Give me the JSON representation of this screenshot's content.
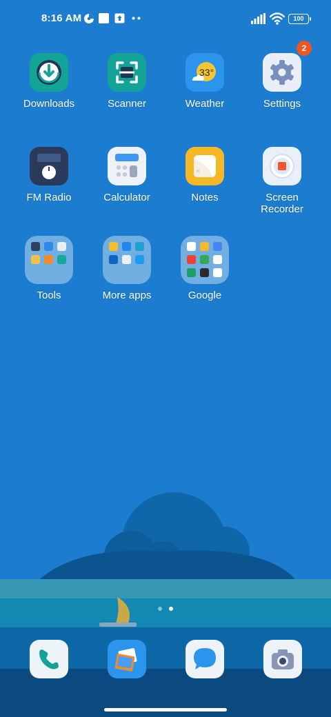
{
  "status_bar": {
    "time": "8:16 AM",
    "battery": "100",
    "icons": [
      "data-saver-icon",
      "app-notification-icon",
      "upload-icon",
      "more-notifications-icon",
      "signal-icon",
      "wifi-icon",
      "battery-icon"
    ]
  },
  "apps": [
    {
      "label": "Downloads",
      "icon": "downloads-icon"
    },
    {
      "label": "Scanner",
      "icon": "scanner-icon"
    },
    {
      "label": "Weather",
      "icon": "weather-icon",
      "temperature": "33°"
    },
    {
      "label": "Settings",
      "icon": "settings-icon",
      "badge": "2"
    },
    {
      "label": "FM Radio",
      "icon": "fm-radio-icon"
    },
    {
      "label": "Calculator",
      "icon": "calculator-icon"
    },
    {
      "label": "Notes",
      "icon": "notes-icon"
    },
    {
      "label": "Screen Recorder",
      "icon": "screen-recorder-icon"
    }
  ],
  "folders": [
    {
      "label": "Tools",
      "mini_icons": [
        "#2f3e5c",
        "#2c8be8",
        "#e9edf4",
        "#f2c14a",
        "#f28c28",
        "#18a79a"
      ]
    },
    {
      "label": "More apps",
      "mini_icons": [
        "#f5c027",
        "#1f88e8",
        "#1e9fd6",
        "#0a66c2",
        "#e8f0fb",
        "#1c9bf0"
      ]
    },
    {
      "label": "Google",
      "mini_icons": [
        "#ffffff",
        "#f7b82a",
        "#4285f4",
        "#ea4335",
        "#34a853",
        "#ffffff",
        "#1a9e6a",
        "#2b2b2b",
        "#ffffff"
      ]
    }
  ],
  "page_indicator": {
    "pages": 2,
    "current": 2
  },
  "dock": [
    {
      "name": "phone",
      "icon": "phone-icon"
    },
    {
      "name": "gallery",
      "icon": "gallery-icon"
    },
    {
      "name": "messages",
      "icon": "messages-icon"
    },
    {
      "name": "camera",
      "icon": "camera-icon"
    }
  ],
  "colors": {
    "wallpaper": "#1b7cd0",
    "badge": "#f0551e",
    "notes": "#f7b825",
    "downloads": "#14a397",
    "weather": "#2b95ee"
  }
}
